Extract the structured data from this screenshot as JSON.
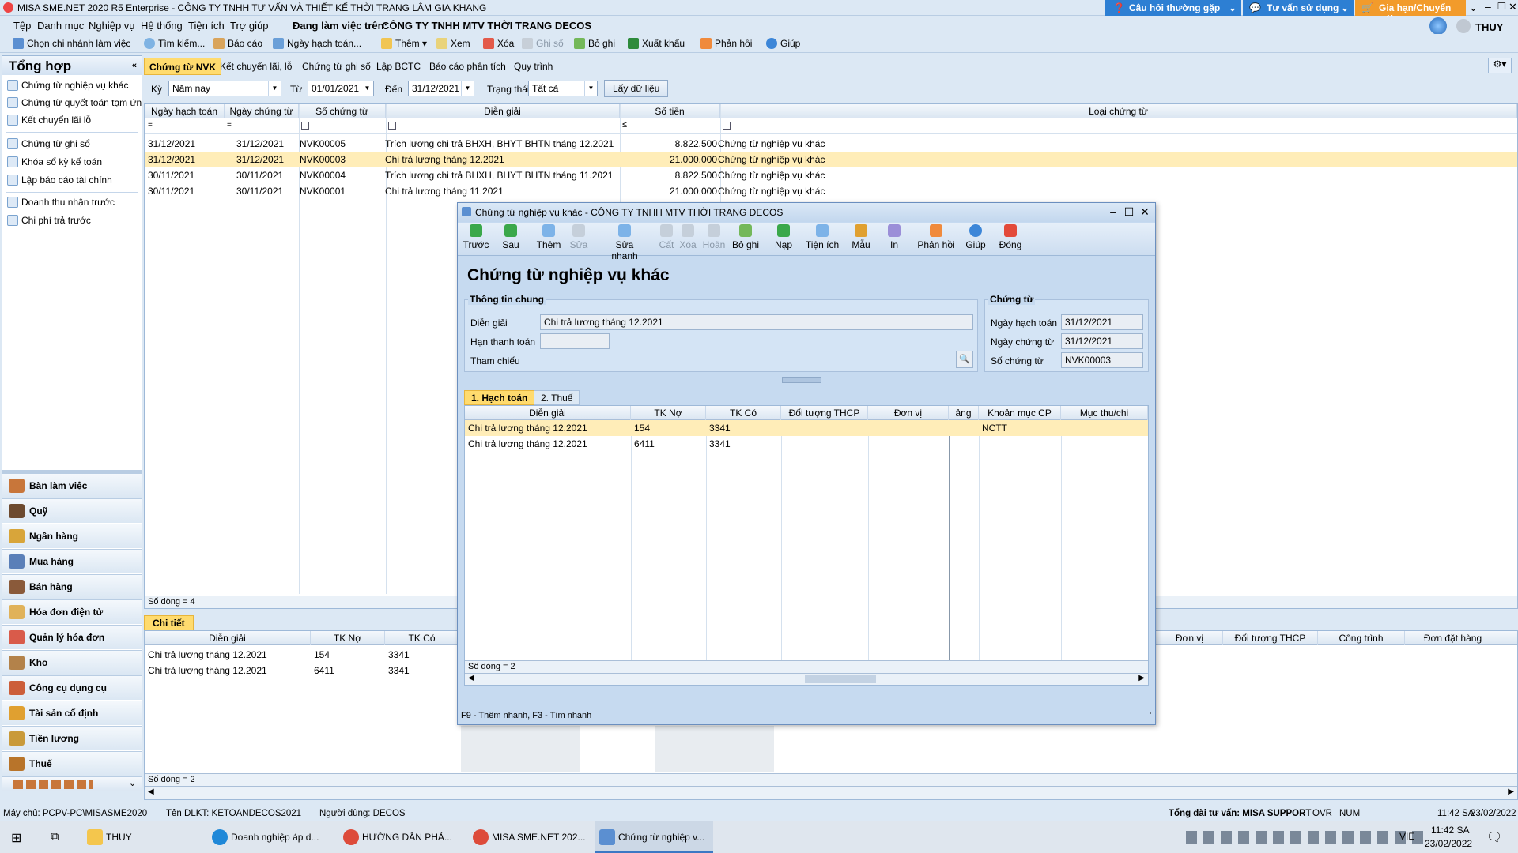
{
  "window": {
    "title": "MISA SME.NET 2020 R5 Enterprise - CÔNG TY TNHH TƯ VẤN VÀ THIẾT KẾ THỜI TRANG LÂM GIA KHANG",
    "faq": "Câu hỏi thường gặp",
    "consult": "Tư vấn sử dụng",
    "renew": "Gia hạn/Chuyển gói",
    "user": "THUY"
  },
  "menu": {
    "items": [
      "Tệp",
      "Danh mục",
      "Nghiệp vụ",
      "Hệ thống",
      "Tiện ích",
      "Trợ giúp"
    ],
    "working_on_label": "Đang làm việc trên:",
    "company": "CÔNG TY TNHH MTV THỜI TRANG DECOS"
  },
  "toolbar": {
    "branch": "Chọn chi nhánh làm việc",
    "search": "Tìm kiếm...",
    "report": "Báo cáo",
    "posting_date": "Ngày hạch toán...",
    "add": "Thêm",
    "view": "Xem",
    "delete": "Xóa",
    "post": "Ghi số",
    "unpost": "Bỏ ghi",
    "export": "Xuất khẩu",
    "feedback": "Phản hồi",
    "help": "Giúp"
  },
  "sidebar": {
    "title": "Tổng hợp",
    "group1": [
      "Chứng từ nghiệp vụ khác",
      "Chứng từ quyết toán tạm ứn...",
      "Kết chuyển lãi lỗ"
    ],
    "group2": [
      "Chứng từ ghi sổ",
      "Khóa sổ kỳ kế toán",
      "Lập báo cáo tài chính"
    ],
    "group3": [
      "Doanh thu nhận trước",
      "Chi phí trả trước"
    ],
    "nav": [
      "Bàn làm việc",
      "Quỹ",
      "Ngân hàng",
      "Mua hàng",
      "Bán hàng",
      "Hóa đơn điện tử",
      "Quản lý hóa đơn",
      "Kho",
      "Công cụ dụng cụ",
      "Tài sản cố định",
      "Tiền lương",
      "Thuế"
    ]
  },
  "tabs": [
    "Chứng từ NVK",
    "Kết chuyển lãi, lỗ",
    "Chứng từ ghi sổ",
    "Lập BCTC",
    "Báo cáo phân tích",
    "Quy trình"
  ],
  "filter": {
    "period_label": "Kỳ",
    "period": "Năm nay",
    "from_label": "Từ",
    "from": "01/01/2021",
    "to_label": "Đến",
    "to": "31/12/2021",
    "status_label": "Trạng thái",
    "status": "Tất cả",
    "get_data": "Lấy dữ liệu"
  },
  "grid": {
    "headers": [
      "Ngày hạch toán",
      "Ngày chứng từ",
      "Số chứng từ",
      "Diễn giải",
      "Số tiền",
      "Loại chứng từ"
    ],
    "rows": [
      [
        "31/12/2021",
        "31/12/2021",
        "NVK00005",
        "Trích lương chi trả BHXH, BHYT BHTN tháng 12.2021",
        "8.822.500",
        "Chứng từ nghiệp vụ khác"
      ],
      [
        "31/12/2021",
        "31/12/2021",
        "NVK00003",
        "Chi trả lương tháng 12.2021",
        "21.000.000",
        "Chứng từ nghiệp vụ khác"
      ],
      [
        "30/11/2021",
        "30/11/2021",
        "NVK00004",
        "Trích lương chi trả BHXH, BHYT BHTN tháng 11.2021",
        "8.822.500",
        "Chứng từ nghiệp vụ khác"
      ],
      [
        "30/11/2021",
        "30/11/2021",
        "NVK00001",
        "Chi trả lương tháng 11.2021",
        "21.000.000",
        "Chứng từ nghiệp vụ khác"
      ]
    ],
    "row_count": "Số dòng = 4"
  },
  "detail": {
    "tab": "Chi tiết",
    "headers": [
      "Diễn giải",
      "TK Nợ",
      "TK Có"
    ],
    "right_headers": [
      "Đơn vị",
      "Đối tượng THCP",
      "Công trình",
      "Đơn đặt hàng"
    ],
    "rows": [
      [
        "Chi trả lương tháng 12.2021",
        "154",
        "3341"
      ],
      [
        "Chi trả lương tháng 12.2021",
        "6411",
        "3341"
      ]
    ],
    "row_count": "Số dòng = 2"
  },
  "dialog": {
    "title": "Chứng từ nghiệp vụ khác - CÔNG TY TNHH MTV THỜI TRANG DECOS",
    "toolbar": [
      "Trước",
      "Sau",
      "Thêm",
      "Sửa",
      "Sửa nhanh",
      "Cất",
      "Xóa",
      "Hoãn",
      "Bỏ ghi",
      "Nạp",
      "Tiện ích",
      "Mẫu",
      "In",
      "Phản hồi",
      "Giúp",
      "Đóng"
    ],
    "heading": "Chứng từ nghiệp vụ khác",
    "general_group": "Thông tin chung",
    "desc_label": "Diễn giải",
    "desc": "Chi trả lương tháng 12.2021",
    "due_label": "Hạn thanh toán",
    "due": "",
    "ref_label": "Tham chiếu",
    "voucher_group": "Chứng từ",
    "posting_label": "Ngày hạch toán",
    "posting": "31/12/2021",
    "voucher_date_label": "Ngày chứng từ",
    "voucher_date": "31/12/2021",
    "voucher_no_label": "Số chứng từ",
    "voucher_no": "NVK00003",
    "tabs": [
      "1. Hạch toán",
      "2. Thuế"
    ],
    "grid_headers": [
      "Diễn giải",
      "TK Nợ",
      "TK Có",
      "Đối tượng THCP",
      "Đơn vị",
      "ảng",
      "Khoản mục CP",
      "Mục thu/chi"
    ],
    "rows": [
      [
        "Chi trả lương tháng 12.2021",
        "154",
        "3341",
        "NCTT"
      ],
      [
        "Chi trả lương tháng 12.2021",
        "6411",
        "3341",
        ""
      ]
    ],
    "row_count": "Số dòng = 2",
    "hint": "F9 - Thêm nhanh, F3 - Tìm nhanh"
  },
  "statusbar": {
    "server": "Máy chủ: PCPV-PC\\MISASME2020",
    "db": "Tên DLKT: KETOANDECOS2021",
    "user": "Người dùng: DECOS",
    "hotline": "Tổng đài tư vấn: MISA SUPPORT",
    "ovr": "OVR",
    "num": "NUM",
    "time": "11:42 SA",
    "date": "23/02/2022"
  },
  "taskbar": {
    "items": [
      "THUY",
      "Doanh nghiệp áp d...",
      "HƯỚNG DẪN PHẢ...",
      "MISA SME.NET 202...",
      "Chứng từ nghiệp v..."
    ],
    "lang": "VIE",
    "time": "11:42 SA",
    "date": "23/02/2022"
  },
  "colors": {
    "accent": "#ffdb6e",
    "selected_row": "#ffedb8",
    "faq_bg": "#2d7fd3",
    "renew_bg": "#f29b2b"
  }
}
